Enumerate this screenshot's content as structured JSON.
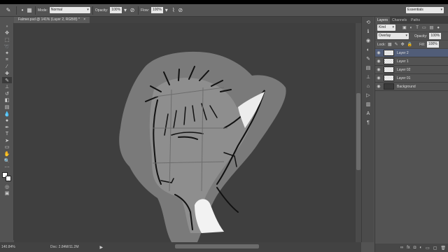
{
  "options_bar": {
    "mode_label": "Mode:",
    "mode_value": "Normal",
    "opacity_label": "Opacity:",
    "opacity_value": "100%",
    "flow_label": "Flow:",
    "flow_value": "100%",
    "workspace": "Essentials"
  },
  "document_tab": {
    "title": "Falmer.psd @ 141% (Layer 2, RGB/8) *"
  },
  "status_bar": {
    "zoom": "140.84%",
    "doc_info": "Doc: 2.84M/11.2M"
  },
  "panel": {
    "tabs": [
      "Layers",
      "Channels",
      "Paths"
    ],
    "kind_label": "Kind",
    "blend_mode": "Overlay",
    "opacity_label": "Opacity:",
    "opacity_value": "100%",
    "lock_label": "Lock:",
    "fill_label": "Fill:",
    "fill_value": "100%",
    "layers": [
      {
        "name": "Layer 2",
        "selected": true
      },
      {
        "name": "Layer 1",
        "selected": false
      },
      {
        "name": "Layer 02",
        "selected": false
      },
      {
        "name": "Layer 01",
        "selected": false
      },
      {
        "name": "Background",
        "selected": false
      }
    ]
  },
  "colors": {
    "accent_selected_layer": "#515d78",
    "ui_bg": "#535353",
    "canvas_bg": "#3f3f3f"
  }
}
